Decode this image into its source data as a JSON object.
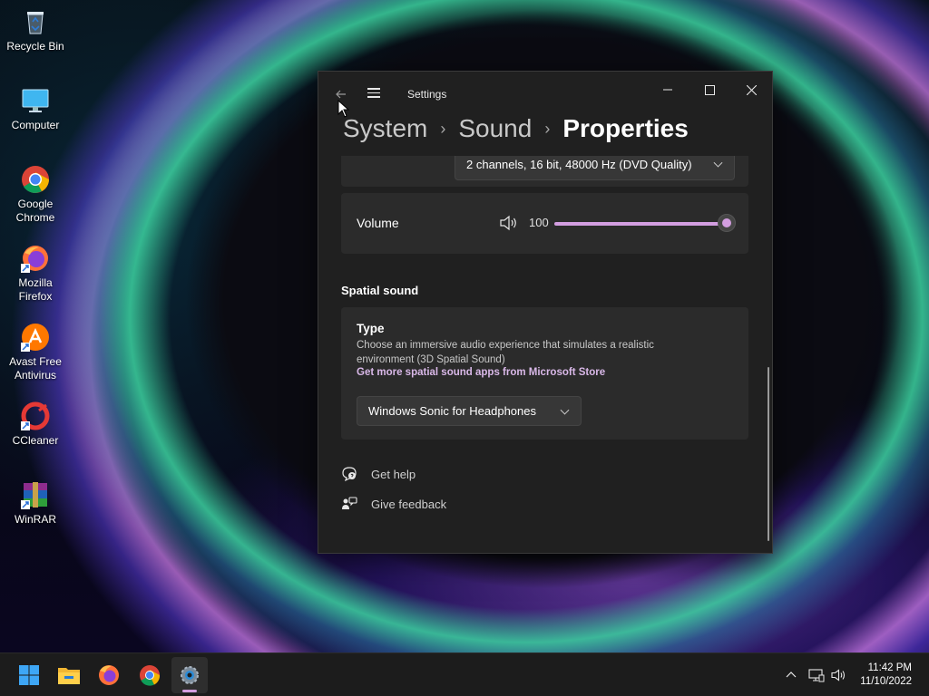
{
  "desktop": {
    "icons": [
      {
        "label": "Recycle Bin",
        "icon": "recycle-bin-icon"
      },
      {
        "label": "Computer",
        "icon": "computer-icon"
      },
      {
        "label": "Google Chrome",
        "icon": "chrome-icon"
      },
      {
        "label": "Mozilla Firefox",
        "icon": "firefox-icon"
      },
      {
        "label": "Avast Free Antivirus",
        "icon": "avast-icon"
      },
      {
        "label": "CCleaner",
        "icon": "ccleaner-icon"
      },
      {
        "label": "WinRAR",
        "icon": "winrar-icon"
      }
    ]
  },
  "window": {
    "title": "Settings",
    "controls": {
      "minimize": "—",
      "maximize": "☐",
      "close": "✕"
    },
    "breadcrumb": {
      "level1": "System",
      "level2": "Sound",
      "current": "Properties",
      "separator": "›"
    },
    "format": {
      "value": "2 channels, 16 bit, 48000 Hz (DVD Quality)"
    },
    "volume": {
      "label": "Volume",
      "value": "100",
      "level_percent": 100
    },
    "spatial": {
      "section_title": "Spatial sound",
      "type_title": "Type",
      "description": "Choose an immersive audio experience that simulates a realistic environment (3D Spatial Sound)",
      "store_link": "Get more spatial sound apps from Microsoft Store",
      "selected": "Windows Sonic for Headphones"
    },
    "links": {
      "help": "Get help",
      "feedback": "Give feedback"
    }
  },
  "taskbar": {
    "apps": [
      "start",
      "file-explorer",
      "firefox",
      "chrome",
      "settings"
    ],
    "clock": {
      "time": "11:42 PM",
      "date": "11/10/2022"
    }
  },
  "colors": {
    "accent": "#d39ee0",
    "window_bg": "#202020",
    "card_bg": "#2b2b2b"
  }
}
